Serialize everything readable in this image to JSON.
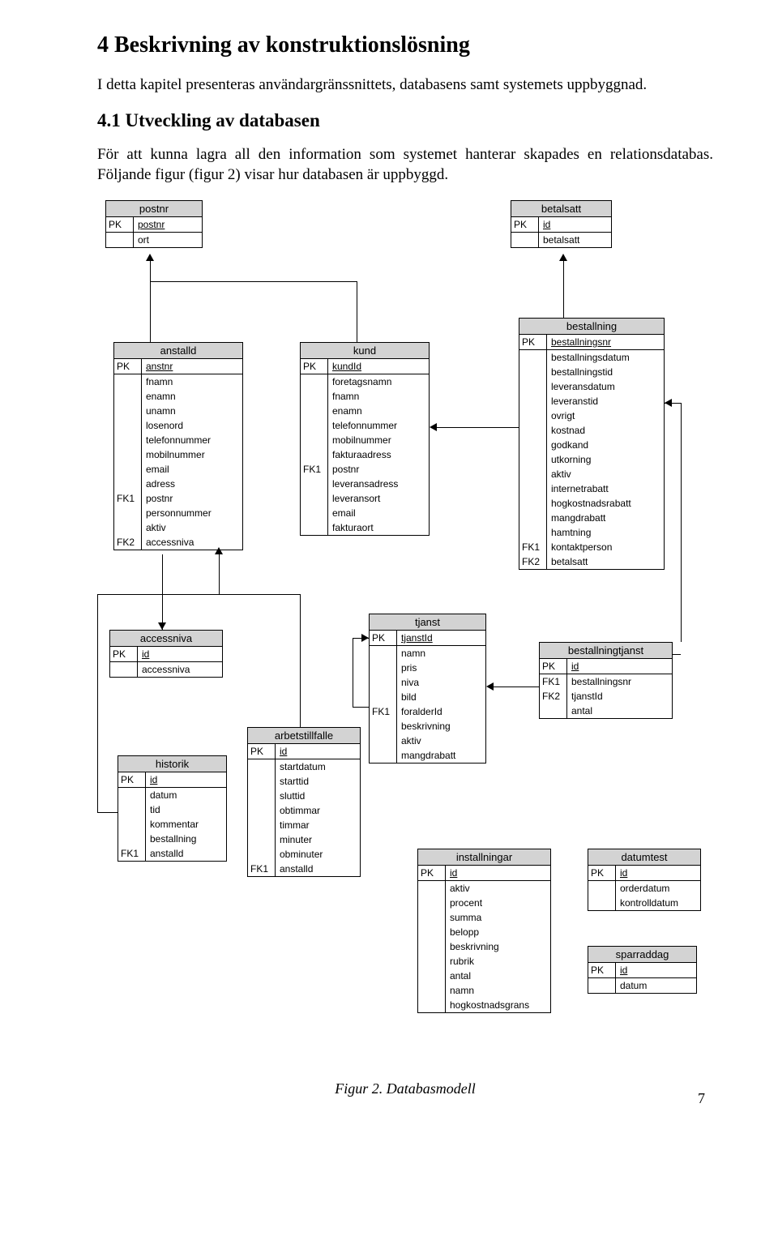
{
  "heading_main": "4   Beskrivning av konstruktionslösning",
  "intro": "I detta kapitel presenteras användargränssnittets, databasens samt systemets uppbyggnad.",
  "heading_sub": "4.1   Utveckling av databasen",
  "para2": "För att kunna lagra all den information som systemet hanterar skapades en relationsdatabas. Följande figur (figur 2) visar hur databasen är uppbyggd.",
  "caption": "Figur 2. Databasmodell",
  "pagenum": "7",
  "entities": {
    "postnr": {
      "title": "postnr",
      "pk": "postnr",
      "attrs": [
        "ort"
      ]
    },
    "betalsatt": {
      "title": "betalsatt",
      "pk": "id",
      "attrs": [
        "betalsatt"
      ]
    },
    "anstalld": {
      "title": "anstalld",
      "pk": "anstnr",
      "rows": [
        {
          "k": "",
          "v": "fnamn"
        },
        {
          "k": "",
          "v": "enamn"
        },
        {
          "k": "",
          "v": "unamn"
        },
        {
          "k": "",
          "v": "losenord"
        },
        {
          "k": "",
          "v": "telefonnummer"
        },
        {
          "k": "",
          "v": "mobilnummer"
        },
        {
          "k": "",
          "v": "email"
        },
        {
          "k": "",
          "v": "adress"
        },
        {
          "k": "FK1",
          "v": "postnr"
        },
        {
          "k": "",
          "v": "personnummer"
        },
        {
          "k": "",
          "v": "aktiv"
        },
        {
          "k": "FK2",
          "v": "accessniva"
        }
      ]
    },
    "kund": {
      "title": "kund",
      "pk": "kundId",
      "rows": [
        {
          "k": "",
          "v": "foretagsnamn"
        },
        {
          "k": "",
          "v": "fnamn"
        },
        {
          "k": "",
          "v": "enamn"
        },
        {
          "k": "",
          "v": "telefonnummer"
        },
        {
          "k": "",
          "v": "mobilnummer"
        },
        {
          "k": "",
          "v": "fakturaadress"
        },
        {
          "k": "FK1",
          "v": "postnr"
        },
        {
          "k": "",
          "v": "leveransadress"
        },
        {
          "k": "",
          "v": "leveransort"
        },
        {
          "k": "",
          "v": "email"
        },
        {
          "k": "",
          "v": "fakturaort"
        }
      ]
    },
    "bestallning": {
      "title": "bestallning",
      "pk": "bestallningsnr",
      "rows": [
        {
          "k": "",
          "v": "bestallningsdatum"
        },
        {
          "k": "",
          "v": "bestallningstid"
        },
        {
          "k": "",
          "v": "leveransdatum"
        },
        {
          "k": "",
          "v": "leveranstid"
        },
        {
          "k": "",
          "v": "ovrigt"
        },
        {
          "k": "",
          "v": "kostnad"
        },
        {
          "k": "",
          "v": "godkand"
        },
        {
          "k": "",
          "v": "utkorning"
        },
        {
          "k": "",
          "v": "aktiv"
        },
        {
          "k": "",
          "v": "internetrabatt"
        },
        {
          "k": "",
          "v": "hogkostnadsrabatt"
        },
        {
          "k": "",
          "v": "mangdrabatt"
        },
        {
          "k": "",
          "v": "hamtning"
        },
        {
          "k": "FK1",
          "v": "kontaktperson"
        },
        {
          "k": "FK2",
          "v": "betalsatt"
        }
      ]
    },
    "accessniva": {
      "title": "accessniva",
      "pk": "id",
      "attrs": [
        "accessniva"
      ]
    },
    "tjanst": {
      "title": "tjanst",
      "pk": "tjanstId",
      "rows": [
        {
          "k": "",
          "v": "namn"
        },
        {
          "k": "",
          "v": "pris"
        },
        {
          "k": "",
          "v": "niva"
        },
        {
          "k": "",
          "v": "bild"
        },
        {
          "k": "FK1",
          "v": "foralderId"
        },
        {
          "k": "",
          "v": "beskrivning"
        },
        {
          "k": "",
          "v": "aktiv"
        },
        {
          "k": "",
          "v": "mangdrabatt"
        }
      ]
    },
    "bestallningtjanst": {
      "title": "bestallningtjanst",
      "pk": "id",
      "rows": [
        {
          "k": "FK1",
          "v": "bestallningsnr"
        },
        {
          "k": "FK2",
          "v": "tjanstId"
        },
        {
          "k": "",
          "v": "antal"
        }
      ]
    },
    "historik": {
      "title": "historik",
      "pk": "id",
      "rows": [
        {
          "k": "",
          "v": "datum"
        },
        {
          "k": "",
          "v": "tid"
        },
        {
          "k": "",
          "v": "kommentar"
        },
        {
          "k": "",
          "v": "bestallning"
        },
        {
          "k": "FK1",
          "v": "anstalld"
        }
      ]
    },
    "arbetstillfalle": {
      "title": "arbetstillfalle",
      "pk": "id",
      "rows": [
        {
          "k": "",
          "v": "startdatum"
        },
        {
          "k": "",
          "v": "starttid"
        },
        {
          "k": "",
          "v": "sluttid"
        },
        {
          "k": "",
          "v": "obtimmar"
        },
        {
          "k": "",
          "v": "timmar"
        },
        {
          "k": "",
          "v": "minuter"
        },
        {
          "k": "",
          "v": "obminuter"
        },
        {
          "k": "FK1",
          "v": "anstalld"
        }
      ]
    },
    "installningar": {
      "title": "installningar",
      "pk": "id",
      "rows": [
        {
          "k": "",
          "v": "aktiv"
        },
        {
          "k": "",
          "v": "procent"
        },
        {
          "k": "",
          "v": "summa"
        },
        {
          "k": "",
          "v": "belopp"
        },
        {
          "k": "",
          "v": "beskrivning"
        },
        {
          "k": "",
          "v": "rubrik"
        },
        {
          "k": "",
          "v": "antal"
        },
        {
          "k": "",
          "v": "namn"
        },
        {
          "k": "",
          "v": "hogkostnadsgrans"
        }
      ]
    },
    "datumtest": {
      "title": "datumtest",
      "pk": "id",
      "attrs": [
        "orderdatum",
        "kontrolldatum"
      ]
    },
    "sparraddag": {
      "title": "sparraddag",
      "pk": "id",
      "attrs": [
        "datum"
      ]
    }
  },
  "key_labels": {
    "PK": "PK"
  }
}
